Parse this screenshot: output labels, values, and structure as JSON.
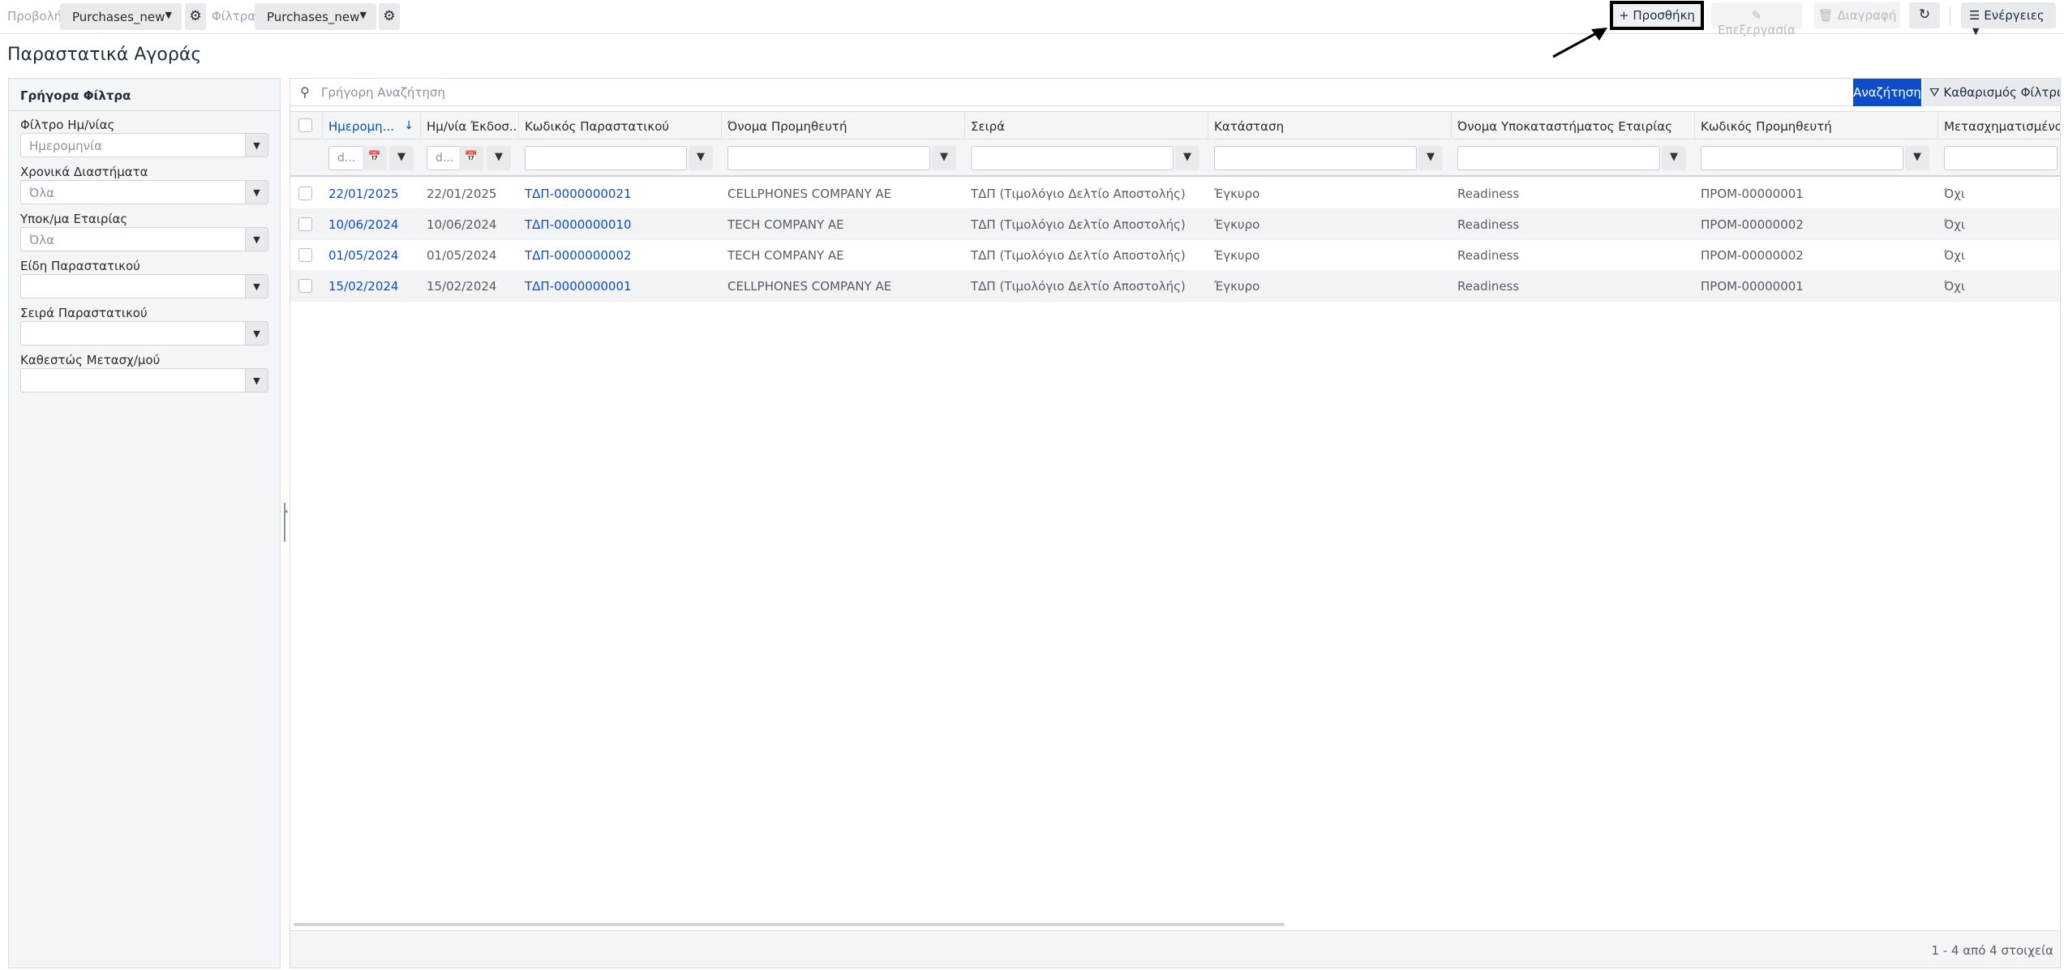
{
  "toolbar": {
    "view_label": "Προβολή",
    "view_value": "Purchases_new",
    "filter_label": "Φίλτρα",
    "filter_value": "Purchases_new",
    "add": "+ Προσθήκη",
    "edit": "Επεξεργασία",
    "delete": "Διαγραφή",
    "actions": "Ενέργειες"
  },
  "page": {
    "title": "Παραστατικά Αγοράς"
  },
  "quick_filters": {
    "title": "Γρήγορα Φίλτρα",
    "items": [
      {
        "label": "Φίλτρο Ημ/νίας",
        "value": "Ημερομηνία"
      },
      {
        "label": "Χρονικά Διαστήματα",
        "value": "Όλα"
      },
      {
        "label": "Υποκ/μα Εταιρίας",
        "value": "Όλα"
      },
      {
        "label": "Είδη Παραστατικού",
        "value": ""
      },
      {
        "label": "Σειρά Παραστατικού",
        "value": ""
      },
      {
        "label": "Καθεστώς Μετασχ/μού",
        "value": ""
      }
    ]
  },
  "grid": {
    "search_placeholder": "Γρήγορη Αναζήτηση",
    "search_button": "Αναζήτηση",
    "clear_button": "Καθαρισμός Φίλτρων",
    "columns": [
      "Ημερομηνία",
      "Ημ/νία Έκδοσης",
      "Κωδικός Παραστατικού",
      "Όνομα Προμηθευτή",
      "Σειρά",
      "Κατάσταση",
      "Όνομα Υποκαταστήματος Εταιρίας",
      "Κωδικός Προμηθευτή",
      "Μετασχηματισμένο"
    ],
    "column_display": [
      "Ημερομη...",
      "Ημ/νία Έκδοσ...",
      "Κωδικός Παραστατικού",
      "Όνομα Προμηθευτή",
      "Σειρά",
      "Κατάσταση",
      "Όνομα Υποκαταστήματος Εταιρίας",
      "Κωδικός Προμηθευτή",
      "Μετασχηματισμένο"
    ],
    "date_filter_placeholder": "d...",
    "rows": [
      [
        "22/01/2025",
        "22/01/2025",
        "ΤΔΠ-0000000021",
        "CELLPHONES COMPANY AE",
        "ΤΔΠ (Τιμολόγιο Δελτίο Αποστολής)",
        "Έγκυρο",
        "Readiness",
        "ΠΡΟΜ-00000001",
        "Όχι"
      ],
      [
        "10/06/2024",
        "10/06/2024",
        "ΤΔΠ-0000000010",
        "TECH COMPANY AE",
        "ΤΔΠ (Τιμολόγιο Δελτίο Αποστολής)",
        "Έγκυρο",
        "Readiness",
        "ΠΡΟΜ-00000002",
        "Όχι"
      ],
      [
        "01/05/2024",
        "01/05/2024",
        "ΤΔΠ-0000000002",
        "TECH COMPANY AE",
        "ΤΔΠ (Τιμολόγιο Δελτίο Αποστολής)",
        "Έγκυρο",
        "Readiness",
        "ΠΡΟΜ-00000002",
        "Όχι"
      ],
      [
        "15/02/2024",
        "15/02/2024",
        "ΤΔΠ-0000000001",
        "CELLPHONES COMPANY AE",
        "ΤΔΠ (Τιμολόγιο Δελτίο Αποστολής)",
        "Έγκυρο",
        "Readiness",
        "ΠΡΟΜ-00000001",
        "Όχι"
      ]
    ],
    "pager_info": "1 - 4 από 4 στοιχεία"
  },
  "colors": {
    "accent": "#0d4dc7",
    "link": "#0d4dc7",
    "panel_bg": "#f4f5f7"
  }
}
